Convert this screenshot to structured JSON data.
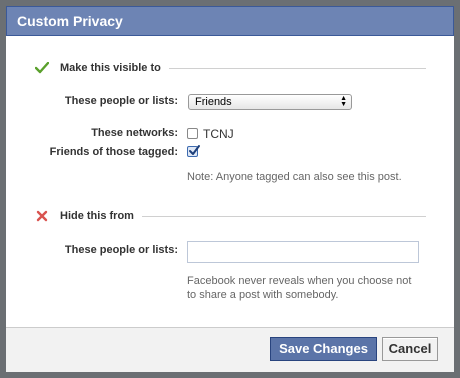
{
  "dialog": {
    "title": "Custom Privacy"
  },
  "visible_section": {
    "heading": "Make this visible to",
    "icon": "check-icon",
    "people_label": "These people or lists:",
    "people_selected": "Friends",
    "networks_label": "These networks:",
    "network_option": "TCNJ",
    "network_checked": false,
    "friends_tagged_label": "Friends of those tagged:",
    "friends_tagged_checked": true,
    "note": "Note: Anyone tagged can also see this post."
  },
  "hide_section": {
    "heading": "Hide this from",
    "icon": "x-icon",
    "people_label": "These people or lists:",
    "people_value": "",
    "note": "Facebook never reveals when you choose not to share a post with somebody."
  },
  "footer": {
    "save_label": "Save Changes",
    "cancel_label": "Cancel"
  },
  "colors": {
    "titlebar": "#6d84b4",
    "primary_button": "#5b74a8",
    "check_green": "#5aa02c",
    "x_red": "#d9534f"
  }
}
